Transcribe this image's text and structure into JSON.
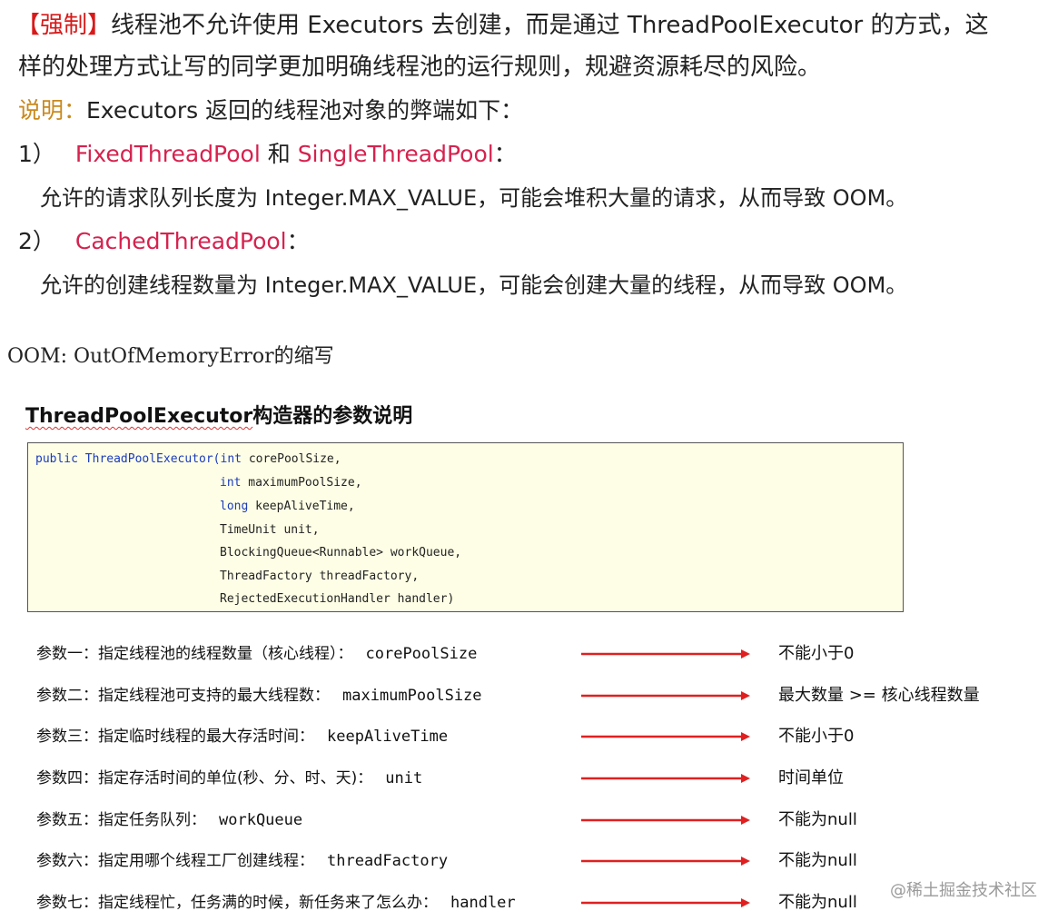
{
  "rule": {
    "tag": "【强制】",
    "line1": "线程池不允许使用 Executors 去创建，而是通过 ThreadPoolExecutor 的方式，这",
    "line2": "样的处理方式让写的同学更加明确线程池的运行规则，规避资源耗尽的风险。"
  },
  "note": {
    "tag": "说明：",
    "text": "Executors 返回的线程池对象的弊端如下："
  },
  "items": [
    {
      "num": "1）",
      "red1": "FixedThreadPool",
      "mid": " 和 ",
      "red2": "SingleThreadPool",
      "tail": "：",
      "detail": "允许的请求队列长度为 Integer.MAX_VALUE，可能会堆积大量的请求，从而导致 OOM。"
    },
    {
      "num": "2）",
      "red1": "CachedThreadPool",
      "tail": "：",
      "detail": "允许的创建线程数量为 Integer.MAX_VALUE，可能会创建大量的线程，从而导致 OOM。"
    }
  ],
  "footnote": "OOM: OutOfMemoryError的缩写",
  "section": {
    "title_word": "ThreadPoolExecutor",
    "title_rest": "构造器的参数说明"
  },
  "code": {
    "l1_kw": "public",
    "l1_name": " ThreadPoolExecutor(",
    "l1_type": "int",
    "l1_param": " corePoolSize,",
    "l2_type": "int",
    "l2_param": " maximumPoolSize,",
    "l3_type": "long",
    "l3_param": " keepAliveTime,",
    "l4": "TimeUnit unit,",
    "l5": "BlockingQueue<Runnable> workQueue,",
    "l6": "ThreadFactory threadFactory,",
    "l7": "RejectedExecutionHandler handler)"
  },
  "params": [
    {
      "label": "参数一：指定线程池的线程数量（核心线程）：",
      "name": "corePoolSize",
      "constraint": "不能小于0"
    },
    {
      "label": "参数二：指定线程池可支持的最大线程数：",
      "name": "maximumPoolSize",
      "constraint": "最大数量 >= 核心线程数量"
    },
    {
      "label": "参数三：指定临时线程的最大存活时间：",
      "name": "keepAliveTime",
      "constraint": "不能小于0"
    },
    {
      "label": "参数四：指定存活时间的单位(秒、分、时、天)：",
      "name": "unit",
      "constraint": "时间单位"
    },
    {
      "label": "参数五：指定任务队列：",
      "name": "workQueue",
      "constraint": "不能为null"
    },
    {
      "label": "参数六：指定用哪个线程工厂创建线程：",
      "name": "threadFactory",
      "constraint": "不能为null"
    },
    {
      "label": "参数七：指定线程忙，任务满的时候，新任务来了怎么办：",
      "name": "handler",
      "constraint": "不能为null"
    }
  ],
  "watermark": "@稀土掘金技术社区",
  "colors": {
    "arrow": "#e02020",
    "force_tag": "#d71a1a",
    "note_tag": "#c9891e",
    "class_red": "#d6224f",
    "code_bg": "#fefee6",
    "keyword": "#1a3bbd"
  }
}
